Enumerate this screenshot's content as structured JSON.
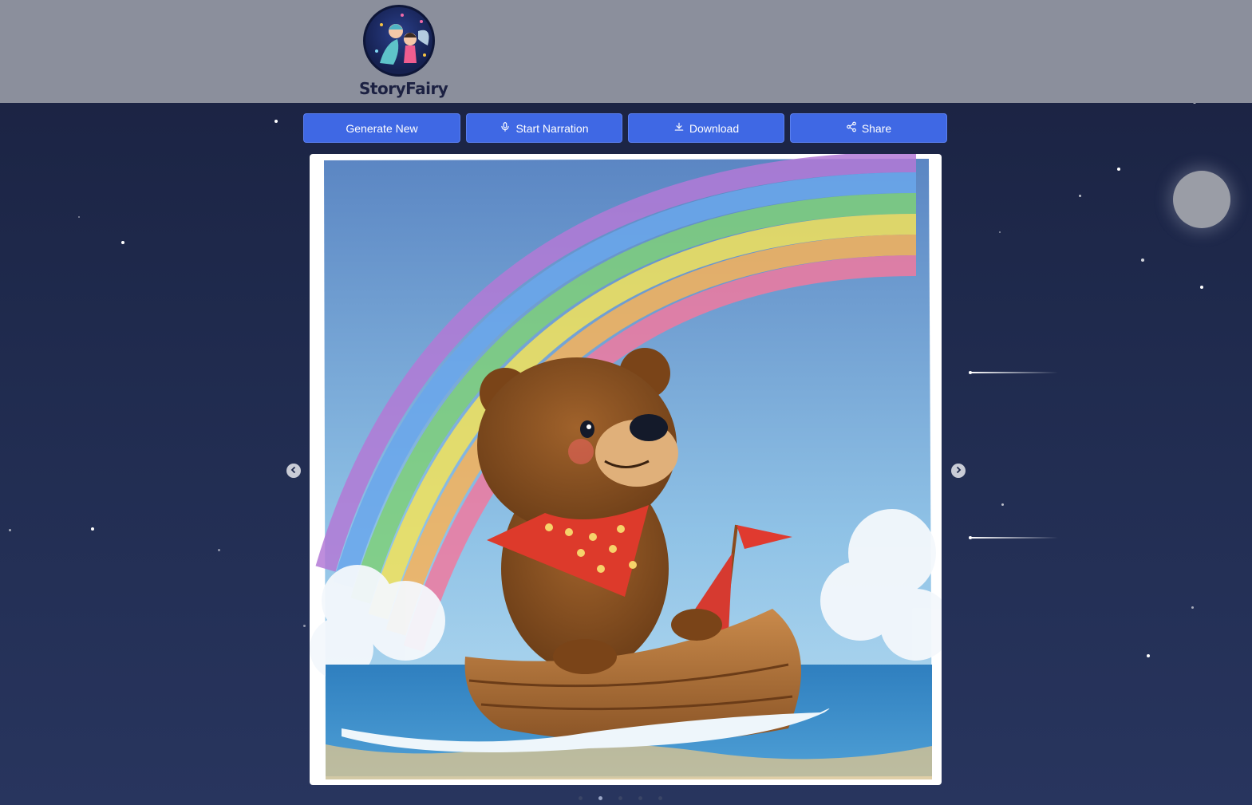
{
  "brand": {
    "name": "StoryFairy"
  },
  "toolbar": {
    "generate_label": "Generate New",
    "narration_label": "Start Narration",
    "download_label": "Download",
    "share_label": "Share"
  },
  "colors": {
    "header_bg": "#8b8f9c",
    "button_bg": "#3f68e4",
    "page_bg": "#1f2a4d"
  },
  "icons": {
    "narration": "microphone-icon",
    "download": "download-icon",
    "share": "share-icon",
    "prev": "chevron-left-icon",
    "next": "chevron-right-icon"
  },
  "carousel": {
    "image_subject": "illustration",
    "slide_count": 5,
    "active_index": 1
  }
}
